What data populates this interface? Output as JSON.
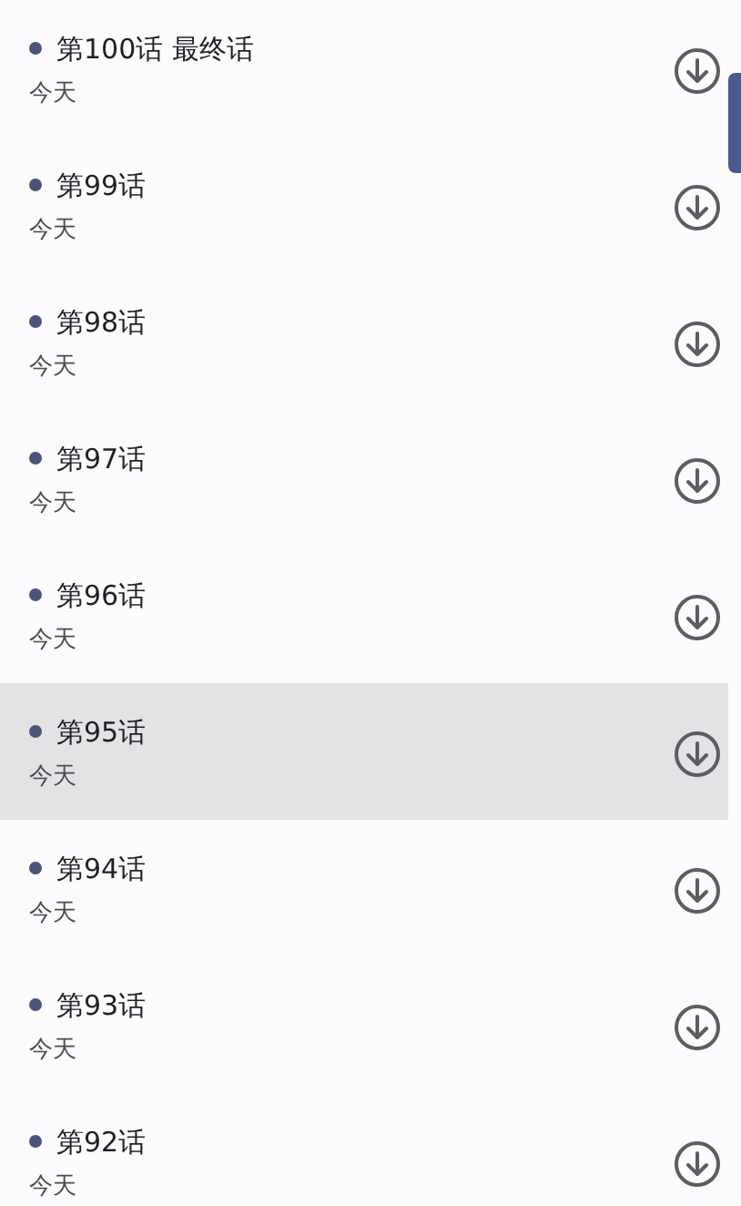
{
  "episodes": [
    {
      "title": "第100话 最终话",
      "date": "今天",
      "selected": false
    },
    {
      "title": "第99话",
      "date": "今天",
      "selected": false
    },
    {
      "title": "第98话",
      "date": "今天",
      "selected": false
    },
    {
      "title": "第97话",
      "date": "今天",
      "selected": false
    },
    {
      "title": "第96话",
      "date": "今天",
      "selected": false
    },
    {
      "title": "第95话",
      "date": "今天",
      "selected": true
    },
    {
      "title": "第94话",
      "date": "今天",
      "selected": false
    },
    {
      "title": "第93话",
      "date": "今天",
      "selected": false
    },
    {
      "title": "第92话",
      "date": "今天",
      "selected": false
    }
  ]
}
